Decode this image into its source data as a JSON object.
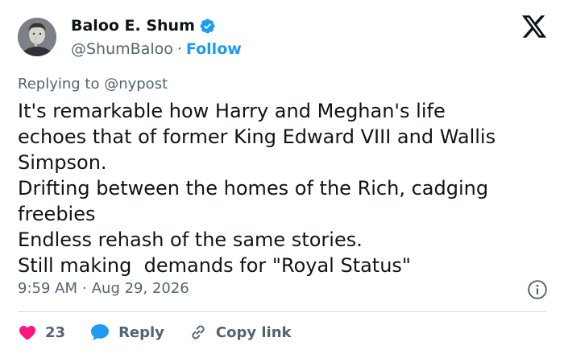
{
  "user": {
    "display_name": "Baloo E. Shum",
    "handle": "@ShumBaloo",
    "separator": "·",
    "follow_label": "Follow"
  },
  "reply_to": "Replying to @nypost",
  "tweet": {
    "lines": [
      "It's remarkable how Harry and Meghan's life",
      "echoes that of former King Edward VIII and Wallis",
      "Simpson.",
      "Drifting between the homes of the Rich, cadging",
      "freebies",
      "Endless rehash of the same stories.",
      "Still making  demands for \"Royal Status\""
    ]
  },
  "meta": {
    "time": "9:59 AM",
    "separator": "·",
    "date": "Aug 29, 2026"
  },
  "actions": {
    "like_count": "23",
    "reply_label": "Reply",
    "copy_link_label": "Copy link"
  },
  "colors": {
    "accent": "#1d9bf0",
    "like": "#f91880",
    "text": "#0f1419",
    "muted": "#536471",
    "divider": "#cfd9de"
  },
  "icons": {
    "verified": "verified-badge-icon",
    "logo": "x-logo-icon",
    "info": "info-icon",
    "like": "heart-icon",
    "reply": "reply-bubble-icon",
    "copy": "link-icon"
  }
}
